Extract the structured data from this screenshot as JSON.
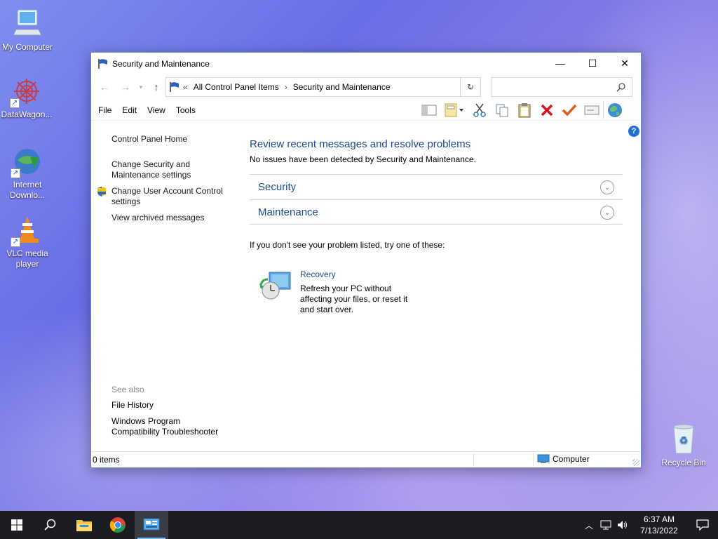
{
  "desktop": {
    "icons": [
      {
        "label": "My Computer"
      },
      {
        "label": "DataWagon..."
      },
      {
        "label": "Internet Downlo..."
      },
      {
        "label": "VLC media player"
      },
      {
        "label": "Recycle Bin"
      }
    ]
  },
  "window": {
    "title": "Security and Maintenance",
    "controls": {
      "minimize": "—",
      "maximize": "☐",
      "close": "✕"
    },
    "address": {
      "prefix": "«",
      "crumbs": [
        "All Control Panel Items",
        "Security and Maintenance"
      ],
      "separator": "›"
    },
    "search": {
      "placeholder": ""
    },
    "menu": [
      "File",
      "Edit",
      "View",
      "Tools"
    ],
    "toolbar": [
      "layout-icon",
      "properties-icon",
      "cut-icon",
      "copy-icon",
      "paste-icon",
      "delete-icon",
      "checkmark-icon",
      "rename-icon",
      "globe-icon"
    ],
    "help_label": "?",
    "sidebar": {
      "links": [
        "Control Panel Home",
        "Change Security and Maintenance settings",
        "Change User Account Control settings",
        "View archived messages"
      ]
    },
    "main": {
      "title": "Review recent messages and resolve problems",
      "subtitle": "No issues have been detected by Security and Maintenance.",
      "sections": [
        "Security",
        "Maintenance"
      ],
      "hint": "If you don't see your problem listed, try one of these:",
      "recovery": {
        "title": "Recovery",
        "description": "Refresh your PC without affecting your files, or reset it and start over."
      }
    },
    "see_also": {
      "heading": "See also",
      "links": [
        "File History",
        "Windows Program Compatibility Troubleshooter"
      ]
    },
    "status": {
      "items": "0 items",
      "zone": "Computer"
    }
  },
  "taskbar": {
    "time": "6:37 AM",
    "date": "7/13/2022"
  },
  "colors": {
    "link": "#1c4a8f",
    "taskbar": "#1c1d22",
    "accent": "#1f6fd1"
  }
}
